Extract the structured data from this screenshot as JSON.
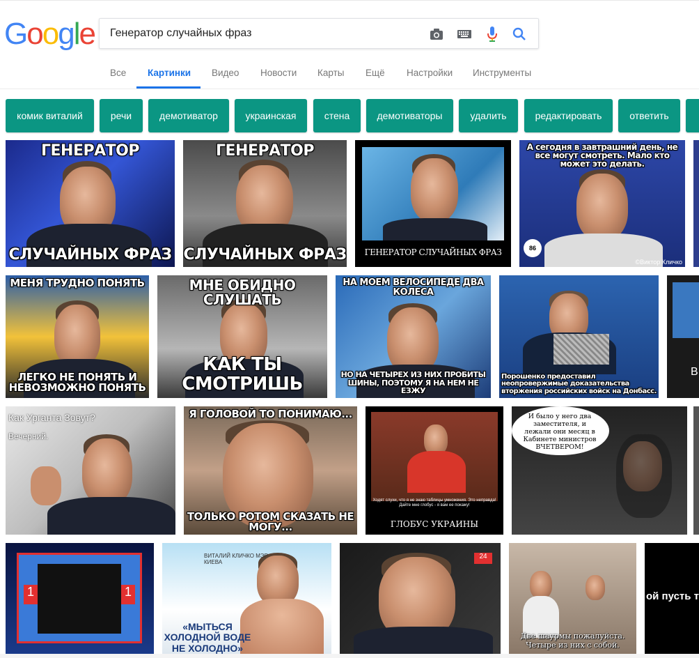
{
  "logo": {
    "letters": [
      "G",
      "o",
      "o",
      "g",
      "l",
      "e"
    ],
    "colors": [
      "#4285f4",
      "#ea4335",
      "#fbbc05",
      "#4285f4",
      "#34a853",
      "#ea4335"
    ]
  },
  "search": {
    "query": "Генератор случайных фраз"
  },
  "tabs": [
    {
      "label": "Все"
    },
    {
      "label": "Картинки",
      "active": true
    },
    {
      "label": "Видео"
    },
    {
      "label": "Новости"
    },
    {
      "label": "Карты"
    },
    {
      "label": "Ещё"
    },
    {
      "label": "Настройки"
    },
    {
      "label": "Инструменты"
    }
  ],
  "chips": [
    {
      "label": "комик виталий"
    },
    {
      "label": "речи"
    },
    {
      "label": "демотиватор"
    },
    {
      "label": "украинская"
    },
    {
      "label": "стена"
    },
    {
      "label": "демотиваторы"
    },
    {
      "label": "удалить"
    },
    {
      "label": "редактировать"
    },
    {
      "label": "ответить"
    }
  ],
  "images": [
    {
      "top": "ГЕНЕРАТОР",
      "bottom": "СЛУЧАЙНЫХ ФРАЗ"
    },
    {
      "top": "ГЕНЕРАТОР",
      "bottom": "СЛУЧАЙНЫХ ФРАЗ"
    },
    {
      "top": "",
      "bottom": "ГЕНЕРАТОР СЛУЧАЙНЫХ ФРАЗ"
    },
    {
      "top": "А сегодня в завтрашний день, не все могут смотреть. Мало кто может это делать.",
      "bottom": "86",
      "extra": "©Виктор Кличко"
    },
    {
      "top": "",
      "bottom": ""
    },
    {
      "top": "МЕНЯ ТРУДНО ПОНЯТЬ",
      "bottom": "ЛЕГКО НЕ ПОНЯТЬ И НЕВОЗМОЖНО ПОНЯТЬ"
    },
    {
      "top": "МНЕ ОБИДНО СЛУШАТЬ",
      "bottom": "КАК ТЫ СМОТРИШЬ"
    },
    {
      "top": "НА МОЕМ ВЕЛОСИПЕДЕ ДВА КОЛЕСА",
      "bottom": "НО НА ЧЕТЫРЕХ ИЗ НИХ ПРОБИТЫ ШИНЫ, ПОЭТОМУ Я НА НЕМ НЕ ЕЗЖУ"
    },
    {
      "top": "",
      "bottom": "Порошенко предоставил неопровержимые доказательства вторжения российских войск на Донбасс."
    },
    {
      "top": "",
      "bottom": "В"
    },
    {
      "top": "Как Урганта Зовут?",
      "bottom": "Вечерний."
    },
    {
      "top": "Я ГОЛОВОЙ ТО ПОНИМАЮ...",
      "bottom": "ТОЛЬКО РОТОМ СКАЗАТЬ НЕ МОГУ..."
    },
    {
      "top": "Ходят слухи, что я не знаю таблицы умножения. Это неправда! Дайте мне глобус - я вам ее покажу!",
      "bottom": "ГЛОБУС УКРАИНЫ"
    },
    {
      "top": "И было у него два заместителя, и лежали они месяц в Кабинете министров ВЧЕТВЕРОМ!",
      "bottom": ""
    },
    {
      "top": "",
      "bottom": ""
    },
    {
      "top": "",
      "bottom": ""
    },
    {
      "top": "ВИТАЛИЙ КЛИЧКО МЭР КИЕВА",
      "bottom": "«МЫТЬСЯ ХОЛОДНОЙ ВОДЕ НЕ ХОЛОДНО»"
    },
    {
      "top": "",
      "bottom": ""
    },
    {
      "top": "",
      "bottom": "Две шаурмы пожалуйста. Четыре из них с собой."
    },
    {
      "top": "",
      "bottom": "ой пусть тот, накид"
    }
  ],
  "chip_color": "#0b9683",
  "accent": "#1a73e8"
}
